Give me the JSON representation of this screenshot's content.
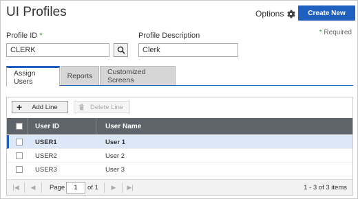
{
  "header": {
    "title": "UI Profiles",
    "options_label": "Options",
    "create_label": "Create New"
  },
  "form": {
    "required_note": "Required",
    "required_star": "*",
    "profile_id_label": "Profile ID",
    "profile_id_value": "CLERK",
    "profile_desc_label": "Profile Description",
    "profile_desc_value": "Clerk"
  },
  "tabs": [
    {
      "label": "Assign Users",
      "active": true
    },
    {
      "label": "Reports",
      "active": false
    },
    {
      "label": "Customized Screens",
      "active": false
    }
  ],
  "toolbar": {
    "add_label": "Add Line",
    "delete_label": "Delete Line"
  },
  "table": {
    "columns": [
      "User ID",
      "User Name"
    ],
    "rows": [
      {
        "user_id": "USER1",
        "user_name": "User 1",
        "selected": true
      },
      {
        "user_id": "USER2",
        "user_name": "User 2",
        "selected": false
      },
      {
        "user_id": "USER3",
        "user_name": "User 3",
        "selected": false
      }
    ]
  },
  "pager": {
    "page_label": "Page",
    "page_value": "1",
    "of_label": "of 1",
    "items_summary": "1 - 3 of 3 items"
  },
  "colors": {
    "accent": "#1f5fbf",
    "header_bg": "#5e6469",
    "required": "#2e9e3e"
  }
}
